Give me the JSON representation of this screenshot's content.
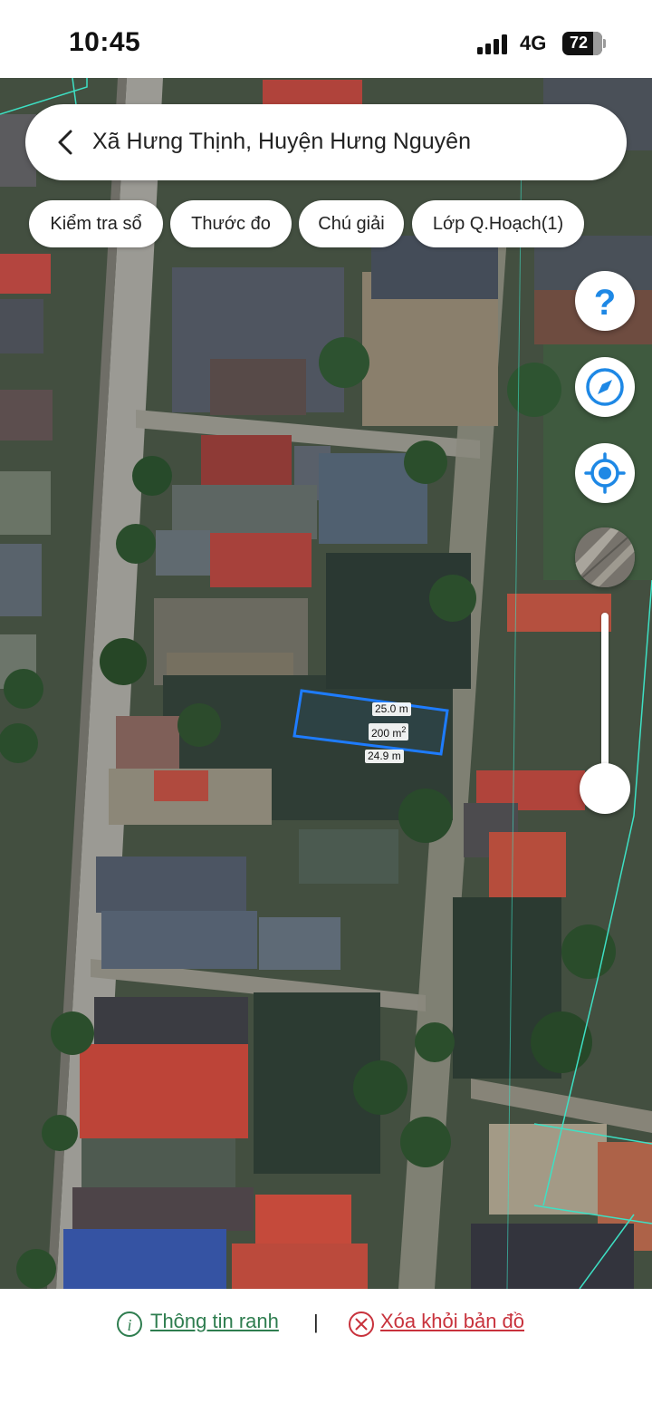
{
  "status_bar": {
    "time": "10:45",
    "network": "4G",
    "battery": "72"
  },
  "search": {
    "title": "Xã Hưng Thịnh, Huyện Hưng Nguyên"
  },
  "chips": [
    {
      "label": "Kiểm tra sổ"
    },
    {
      "label": "Thước đo"
    },
    {
      "label": "Chú giải"
    },
    {
      "label": "Lớp Q.Hoạch(1)"
    }
  ],
  "map_controls": {
    "help_icon": "?",
    "icons": [
      "help-icon",
      "compass-icon",
      "locate-icon",
      "layer-thumbnail"
    ],
    "zoom_level": 0.12
  },
  "parcel": {
    "top_length": "25.0 m",
    "area": "200 m",
    "area_unit_sup": "2",
    "bottom_length": "24.9 m",
    "outline_color": "#1e7cff"
  },
  "actions": {
    "info_label": "Thông tin ranh",
    "separator": "|",
    "remove_label": "Xóa khỏi bản đồ",
    "info_color": "#2e7d4f",
    "remove_color": "#c8323c"
  }
}
